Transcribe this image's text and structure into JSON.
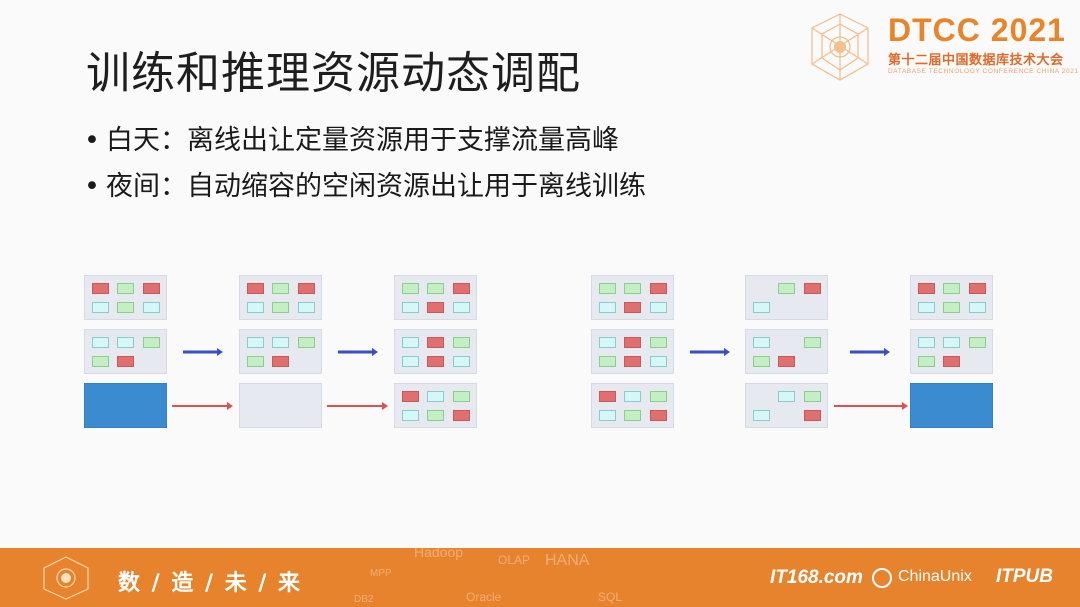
{
  "slide": {
    "title": "训练和推理资源动态调配",
    "bullets": [
      "白天：离线出让定量资源用于支撑流量高峰",
      "夜间：自动缩容的空闲资源出让用于离线训练"
    ]
  },
  "logo": {
    "name": "DTCC 2021",
    "subtitle": "第十二届中国数据库技术大会",
    "tagline": "DATABASE TECHNOLOGY CONFERENCE CHINA 2021"
  },
  "footer": {
    "slogan": "数 / 造 / 未 / 来",
    "watermarks": [
      "Hadoop",
      "OLAP",
      "HANA",
      "MPP",
      "DB2",
      "Oracle",
      "SQL"
    ],
    "sponsors": [
      "IT168.com",
      "ChinaUnix",
      "ITPUB"
    ]
  },
  "colors": {
    "red_cell": "#e07070",
    "green_cell": "#c4eec4",
    "cyan_cell": "#d5f7f7",
    "filled_box": "#3b8bd0",
    "blue_arrow": "#3a4fc4",
    "red_arrow": "#e05050",
    "brand_orange": "#e8832d"
  },
  "diagram": {
    "legend_note": "",
    "left_group": {
      "columns": [
        [
          {
            "cells": [
              [
                "r",
                "g",
                "r"
              ],
              [
                "c",
                "g",
                "c"
              ]
            ]
          },
          {
            "cells": [
              [
                "c",
                "c",
                "g"
              ],
              [
                "g",
                "r",
                ""
              ]
            ]
          },
          {
            "filled": true
          }
        ],
        [
          {
            "cells": [
              [
                "r",
                "g",
                "r"
              ],
              [
                "c",
                "g",
                "c"
              ]
            ]
          },
          {
            "cells": [
              [
                "c",
                "c",
                "g"
              ],
              [
                "g",
                "r",
                ""
              ]
            ]
          },
          {
            "empty": true
          }
        ],
        [
          {
            "cells": [
              [
                "g",
                "g",
                "r"
              ],
              [
                "c",
                "r",
                "c"
              ]
            ]
          },
          {
            "cells": [
              [
                "c",
                "r",
                "g"
              ],
              [
                "c",
                "r",
                "c"
              ]
            ]
          },
          {
            "cells": [
              [
                "r",
                "c",
                "g"
              ],
              [
                "c",
                "g",
                "r"
              ]
            ]
          }
        ]
      ],
      "arrows": [
        "blue",
        "red"
      ]
    },
    "right_group": {
      "columns": [
        [
          {
            "cells": [
              [
                "g",
                "g",
                "r"
              ],
              [
                "c",
                "r",
                "c"
              ]
            ]
          },
          {
            "cells": [
              [
                "c",
                "r",
                "g"
              ],
              [
                "g",
                "r",
                "c"
              ]
            ]
          },
          {
            "cells": [
              [
                "r",
                "c",
                "g"
              ],
              [
                "c",
                "g",
                "r"
              ]
            ]
          }
        ],
        [
          {
            "cells": [
              [
                "",
                "g",
                "r"
              ],
              [
                "c",
                "",
                ""
              ]
            ]
          },
          {
            "cells": [
              [
                "c",
                "",
                "g"
              ],
              [
                "g",
                "r",
                ""
              ]
            ]
          },
          {
            "cells": [
              [
                "",
                "c",
                "g"
              ],
              [
                "c",
                "",
                "r"
              ]
            ]
          }
        ],
        [
          {
            "cells": [
              [
                "r",
                "g",
                "r"
              ],
              [
                "c",
                "g",
                "c"
              ]
            ]
          },
          {
            "cells": [
              [
                "c",
                "c",
                "g"
              ],
              [
                "g",
                "r",
                ""
              ]
            ]
          },
          {
            "filled": true
          }
        ]
      ],
      "arrows": [
        "blue",
        "red"
      ]
    }
  }
}
